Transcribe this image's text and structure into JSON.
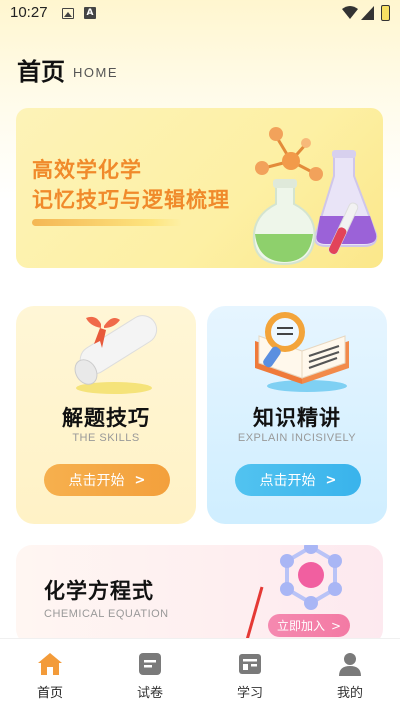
{
  "status_bar": {
    "time": "10:27"
  },
  "header": {
    "title": "首页",
    "subtitle": "HOME"
  },
  "banner": {
    "line1": "高效学化学",
    "line2": "记忆技巧与逻辑梳理"
  },
  "cards": [
    {
      "title": "解题技巧",
      "subtitle": "THE SKILLS",
      "button": "点击开始",
      "button_arrow": ">",
      "accent": "#f6b04e"
    },
    {
      "title": "知识精讲",
      "subtitle": "EXPLAIN INCISIVELY",
      "button": "点击开始",
      "button_arrow": ">",
      "accent": "#39b3ec"
    }
  ],
  "equation_card": {
    "title": "化学方程式",
    "subtitle": "CHEMICAL EQUATION",
    "button": "立即加入",
    "button_arrow": ">",
    "accent": "#f37aa4"
  },
  "bottom_nav": [
    {
      "label": "首页",
      "icon": "home-icon",
      "active": true
    },
    {
      "label": "试卷",
      "icon": "paper-icon",
      "active": false
    },
    {
      "label": "学习",
      "icon": "study-icon",
      "active": false
    },
    {
      "label": "我的",
      "icon": "profile-icon",
      "active": false
    }
  ],
  "colors": {
    "brand_orange": "#f08a2b",
    "active_nav": "#f39b3a",
    "inactive_nav": "#7a7a7a",
    "annotation": "#e53935"
  }
}
